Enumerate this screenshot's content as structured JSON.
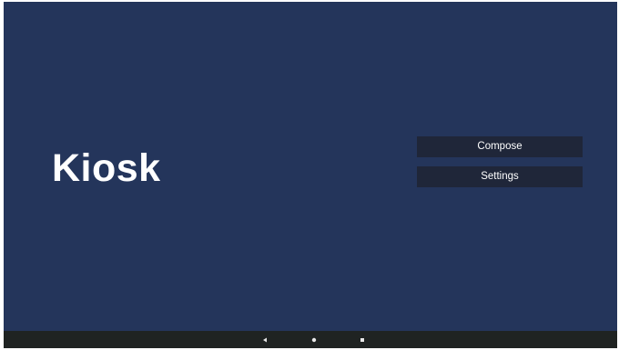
{
  "screen": {
    "background": "#24355b"
  },
  "app": {
    "title": "Kiosk"
  },
  "menu": {
    "compose_label": "Compose",
    "settings_label": "Settings",
    "button_color": "#1f2639"
  },
  "navigation_bar": {
    "background": "#1f2322",
    "icons": [
      "back-icon",
      "home-icon",
      "recents-icon"
    ]
  }
}
